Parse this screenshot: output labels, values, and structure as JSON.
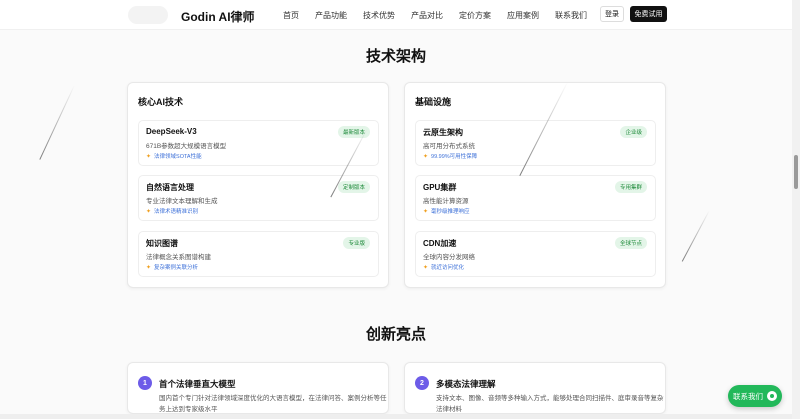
{
  "nav": {
    "brand": "Godin AI律师",
    "menu": [
      "首页",
      "产品功能",
      "技术优势",
      "产品对比",
      "定价方案",
      "应用案例",
      "联系我们"
    ],
    "login": "登录",
    "trial": "免费试用"
  },
  "tech": {
    "title": "技术架构",
    "left_card": {
      "title": "核心AI技术",
      "items": [
        {
          "name": "DeepSeek-V3",
          "desc": "671B参数超大规模语言模型",
          "feature": "法律领域SOTA性能",
          "badge": "最新版本"
        },
        {
          "name": "自然语言处理",
          "desc": "专业法律文本理解和生成",
          "feature": "法律术语精准识别",
          "badge": "定制版本"
        },
        {
          "name": "知识图谱",
          "desc": "法律概念关系图谱构建",
          "feature": "复杂案例关联分析",
          "badge": "专业版"
        }
      ]
    },
    "right_card": {
      "title": "基础设施",
      "items": [
        {
          "name": "云原生架构",
          "desc": "高可用分布式系统",
          "feature": "99.99%可用性保障",
          "badge": "企业级"
        },
        {
          "name": "GPU集群",
          "desc": "高性能计算资源",
          "feature": "毫秒级推理响应",
          "badge": "专用集群"
        },
        {
          "name": "CDN加速",
          "desc": "全球内容分发网络",
          "feature": "就近访问优化",
          "badge": "全球节点"
        }
      ]
    }
  },
  "innovation": {
    "title": "创新亮点",
    "cards": [
      {
        "num": "1",
        "title": "首个法律垂直大模型",
        "desc": "国内首个专门针对法律领域深度优化的大语言模型，在法律问答、案例分析等任务上达到专家级水平"
      },
      {
        "num": "2",
        "title": "多模态法律理解",
        "desc": "支持文本、图像、音频等多种输入方式，能够处理合同扫描件、庭审录音等复杂法律材料"
      }
    ]
  },
  "contact_fab": "联系我们",
  "colors": {
    "accent": "#6d5ce8",
    "badge_green": "#1e8a3a",
    "feature_blue": "#3b6fd8",
    "fab_green": "#22b85a"
  }
}
